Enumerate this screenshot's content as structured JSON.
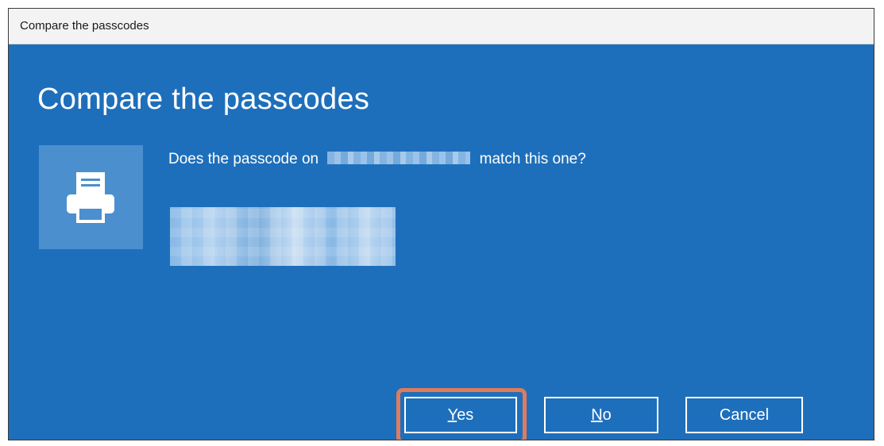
{
  "window": {
    "title": "Compare the passcodes"
  },
  "dialog": {
    "heading": "Compare the passcodes",
    "question_prefix": "Does the passcode on",
    "device_name": "",
    "question_suffix": "match this one?",
    "passcode": "",
    "device_icon": "printer-icon"
  },
  "buttons": {
    "yes_accel": "Y",
    "yes_rest": "es",
    "no_accel": "N",
    "no_rest": "o",
    "cancel": "Cancel"
  },
  "colors": {
    "background": "#1e6fbb",
    "tile": "#4b8fcf",
    "highlight": "#e07b5d"
  }
}
